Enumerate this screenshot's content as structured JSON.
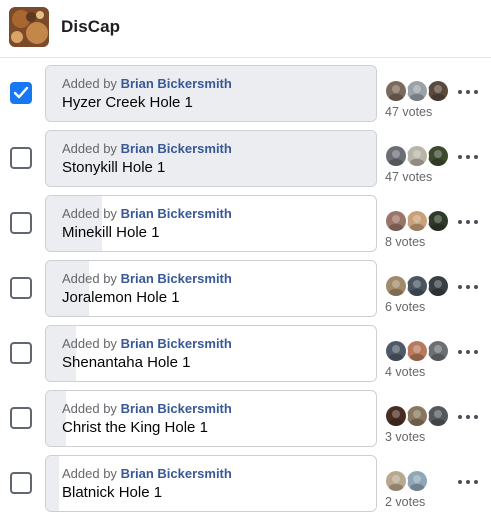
{
  "group": {
    "title": "DisCap"
  },
  "colors": {
    "accent": "#1877f2",
    "author": "#385898",
    "muted": "#65676b",
    "bar": "#ebedf0"
  },
  "poll": {
    "added_by_prefix": "Added by",
    "options": [
      {
        "label": "Hyzer Creek Hole 1",
        "author": "Brian Bickersmith",
        "votes_text": "47 votes",
        "checked": true,
        "share": 1.0,
        "voter_colors": [
          "#7a6a5c",
          "#9aa1a8",
          "#5a4a3c"
        ]
      },
      {
        "label": "Stonykill Hole 1",
        "author": "Brian Bickersmith",
        "votes_text": "47 votes",
        "checked": false,
        "share": 1.0,
        "voter_colors": [
          "#6b6f75",
          "#b9b4a8",
          "#3d4a2e"
        ]
      },
      {
        "label": "Minekill Hole 1",
        "author": "Brian Bickersmith",
        "votes_text": "8 votes",
        "checked": false,
        "share": 0.17,
        "voter_colors": [
          "#9a7468",
          "#c9a07a",
          "#2f3a2a"
        ]
      },
      {
        "label": "Joralemon Hole 1",
        "author": "Brian Bickersmith",
        "votes_text": "6 votes",
        "checked": false,
        "share": 0.13,
        "voter_colors": [
          "#a08a6a",
          "#4a5560",
          "#3a3f45"
        ]
      },
      {
        "label": "Shenantaha Hole 1",
        "author": "Brian Bickersmith",
        "votes_text": "4 votes",
        "checked": false,
        "share": 0.09,
        "voter_colors": [
          "#4f5a68",
          "#b77a5e",
          "#6c6f72"
        ]
      },
      {
        "label": "Christ the King Hole 1",
        "author": "Brian Bickersmith",
        "votes_text": "3 votes",
        "checked": false,
        "share": 0.06,
        "voter_colors": [
          "#4a2d22",
          "#8a7760",
          "#55585c"
        ]
      },
      {
        "label": "Blatnick Hole 1",
        "author": "Brian Bickersmith",
        "votes_text": "2 votes",
        "checked": false,
        "share": 0.04,
        "voter_colors": [
          "#b8a890",
          "#8fa6b8"
        ]
      }
    ]
  }
}
